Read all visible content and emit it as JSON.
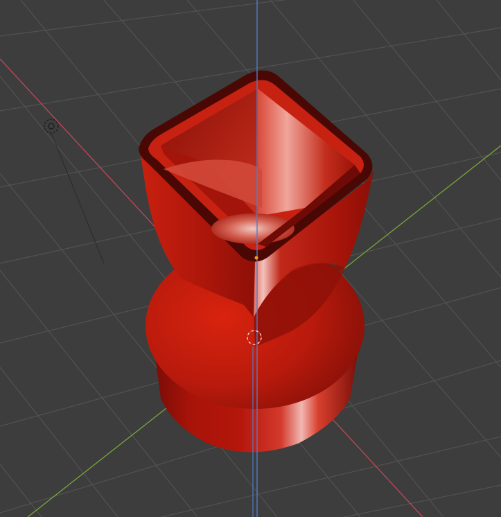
{
  "viewport": {
    "background_color": "#3d3d3d",
    "grid_color": "#535353",
    "object_color": "#c8200f",
    "object_highlight_color": "#f4b3ad",
    "object_shadow_color": "#5a0906"
  },
  "axes": {
    "x_axis_color": "#c0485a",
    "y_axis_color": "#7aa83a",
    "z_axis_color": "#4d7ec9"
  },
  "icons": {
    "light": "light-icon",
    "origin": "object-origin-dot-icon",
    "cursor": "3d-cursor-icon"
  }
}
